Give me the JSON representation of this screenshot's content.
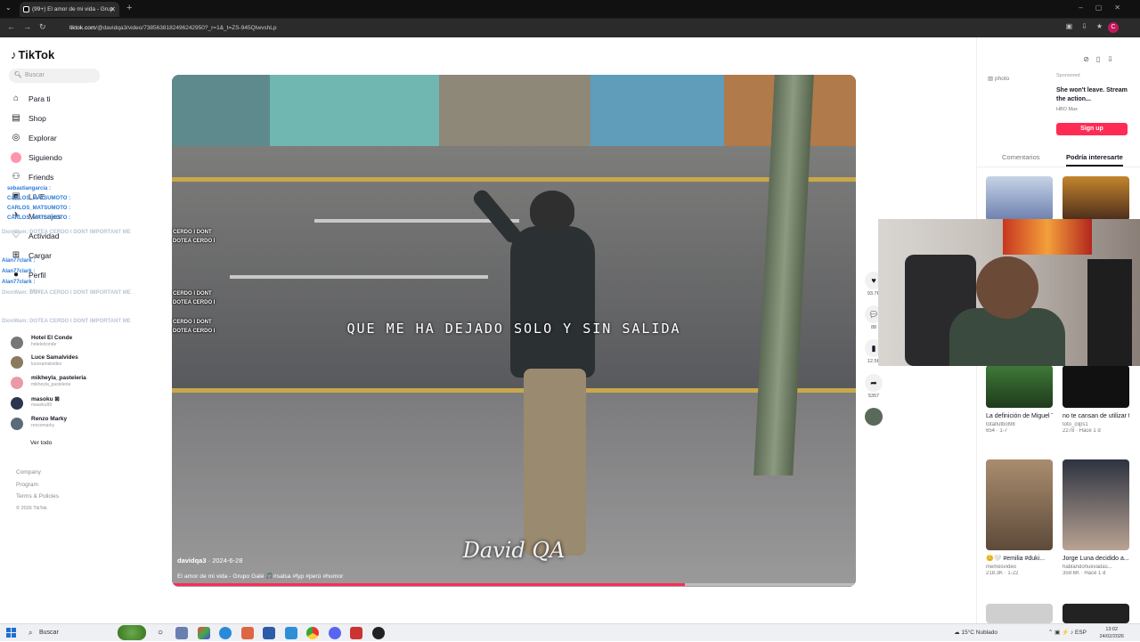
{
  "browser": {
    "tab_title": "(99+) El amor de mi vida - Grup",
    "url_domain": "tiktok.com",
    "url_path": "/@davidqa3/video/7385638182496242950?_r=1&_t=ZS-945QIwvshLp",
    "profile_initial": "C"
  },
  "sidebar": {
    "logo": "TikTok",
    "search_placeholder": "Buscar",
    "nav": [
      {
        "label": "Para ti",
        "icon": "home-icon"
      },
      {
        "label": "Shop",
        "icon": "shop-icon"
      },
      {
        "label": "Explorar",
        "icon": "compass-icon"
      },
      {
        "label": "Siguiendo",
        "icon": "following-icon"
      },
      {
        "label": "Friends",
        "icon": "friends-icon"
      },
      {
        "label": "LIVE",
        "icon": "live-icon"
      },
      {
        "label": "Mensajes",
        "icon": "messages-icon"
      },
      {
        "label": "Actividad",
        "icon": "activity-icon"
      },
      {
        "label": "Cargar",
        "icon": "upload-icon"
      },
      {
        "label": "Perfil",
        "icon": "profile-icon"
      }
    ],
    "following_title": "Más",
    "following": [
      {
        "name": "Hotel El Conde",
        "handle": "hotelelconde"
      },
      {
        "name": "Luce Samalvides",
        "handle": "lucesamalvides"
      },
      {
        "name": "mikheyla_pasteleria",
        "handle": "mikheyla_pasteleria"
      },
      {
        "name": "masoku ⊠",
        "handle": "masoku99"
      },
      {
        "name": "Renzo Marky",
        "handle": "renzomarky"
      }
    ],
    "see_all": "Ver todo",
    "footer": [
      "Company",
      "Program",
      "Terms & Policies"
    ],
    "copyright": "© 2026 TikTok"
  },
  "chat": {
    "lines": [
      "sebastiangarcia :",
      "CARLOS_MATSUMOTO :",
      "CARLOS_MATSUMOTO :",
      "CARLOS_MATSUMOTO :",
      "DionWam: DOTEA CERDO I DONT IMPORTANT ME",
      "Alan77clark :",
      "Alan77clark :",
      "Alan77clark :",
      "DionWam: DOTEA CERDO I DONT IMPORTANT ME",
      "DionWam: DOTEA CERDO I DONT IMPORTANT ME"
    ],
    "dotea": [
      "CERDO I DONT",
      "DOTEA CERDO I",
      "CERDO I DONT",
      "DOTEA CERDO I",
      "CERDO I DONT",
      "DOTEA CERDO I"
    ]
  },
  "video": {
    "lyrics": "QUE ME HA DEJADO SOLO Y SIN SALIDA",
    "watermark": "David QA",
    "author": "davidqa3",
    "date": "2024-6-28",
    "description": "El amor de mi vida - Grupo Galé 🎵#salsa #fyp #perú #humor",
    "progress": 0.75
  },
  "actions": {
    "likes": "93.7K",
    "comments": "88",
    "saves": "12.5K",
    "shares": "5357"
  },
  "ad": {
    "photo_alt": "photo",
    "sponsored": "Sponsored",
    "title": "She won't leave. Stream the action...",
    "brand": "HBO Max",
    "cta": "Sign up"
  },
  "right_tabs": [
    "Comentarios",
    "Podría interesarte"
  ],
  "recommendations": [
    {
      "title": "La definición de Miguel Trauco #...",
      "author": "totalfutbol98",
      "meta": "654 · 1-7"
    },
    {
      "title": "no te cansan de utilizar tantos bo...",
      "author": "toto_clips1",
      "meta": "2278 · Hace 1 d"
    },
    {
      "title": "😊🤍 #emilia #duki...",
      "author": "memesvideo",
      "meta": "218.3K · 1-22"
    },
    {
      "title": "Jorge Luna decidido a...",
      "author": "hablandohuevadas...",
      "meta": "359.6K · Hace 1 d"
    }
  ],
  "taskbar": {
    "search": "Buscar",
    "weather": "15°C Nublado",
    "lang": "ESP",
    "time": "13:02",
    "date": "24/02/2026"
  },
  "colors": {
    "accent": "#fe2c55",
    "link": "#2a7bd8"
  }
}
